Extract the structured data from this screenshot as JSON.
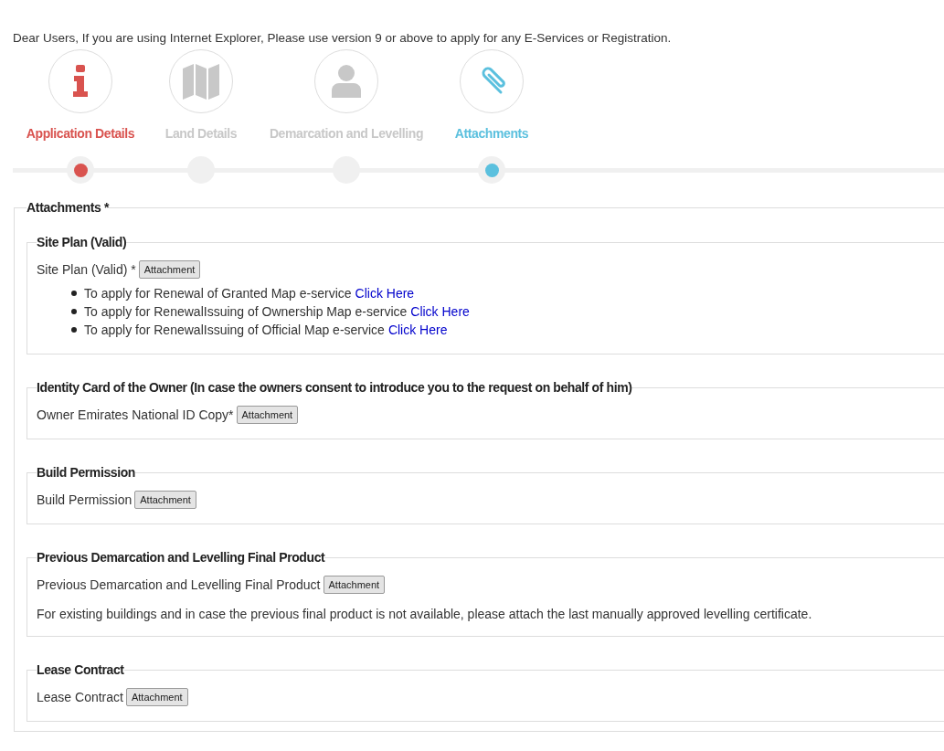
{
  "notice": "Dear Users, If you are using Internet Explorer, Please use version 9 or above to apply for any E-Services or Registration.",
  "steps": [
    {
      "label": "Application Details",
      "kind": "info",
      "color": "#d9534f",
      "marked": true
    },
    {
      "label": "Land Details",
      "kind": "map",
      "color": "#c8c8c8",
      "marked": false
    },
    {
      "label": "Demarcation and Levelling",
      "kind": "person",
      "color": "#c8c8c8",
      "marked": false
    },
    {
      "label": "Attachments",
      "kind": "paperclip",
      "color": "#5bc0de",
      "marked": true
    }
  ],
  "attachments": {
    "legend": "Attachments *",
    "sections": [
      {
        "title": "Site Plan (Valid)",
        "field_label": "Site Plan (Valid) *",
        "button": "Attachment",
        "links": [
          {
            "text": "To apply for Renewal of Granted Map e-service",
            "link": "Click Here"
          },
          {
            "text": "To apply for RenewalIssuing of Ownership Map e-service",
            "link": "Click Here"
          },
          {
            "text": "To apply for RenewalIssuing of Official Map e-service",
            "link": "Click Here"
          }
        ]
      },
      {
        "title": "Identity Card of the Owner (In case the owners consent to introduce you to the request on behalf of him)",
        "field_label": "Owner Emirates National ID Copy*",
        "button": "Attachment"
      },
      {
        "title": "Build Permission",
        "field_label": "Build Permission",
        "button": "Attachment"
      },
      {
        "title": "Previous Demarcation and Levelling Final Product",
        "field_label": "Previous Demarcation and Levelling Final Product",
        "button": "Attachment",
        "note": "For existing buildings and in case the previous final product is not available, please attach the last manually approved levelling certificate."
      },
      {
        "title": "Lease Contract",
        "field_label": "Lease Contract",
        "button": "Attachment"
      }
    ]
  }
}
